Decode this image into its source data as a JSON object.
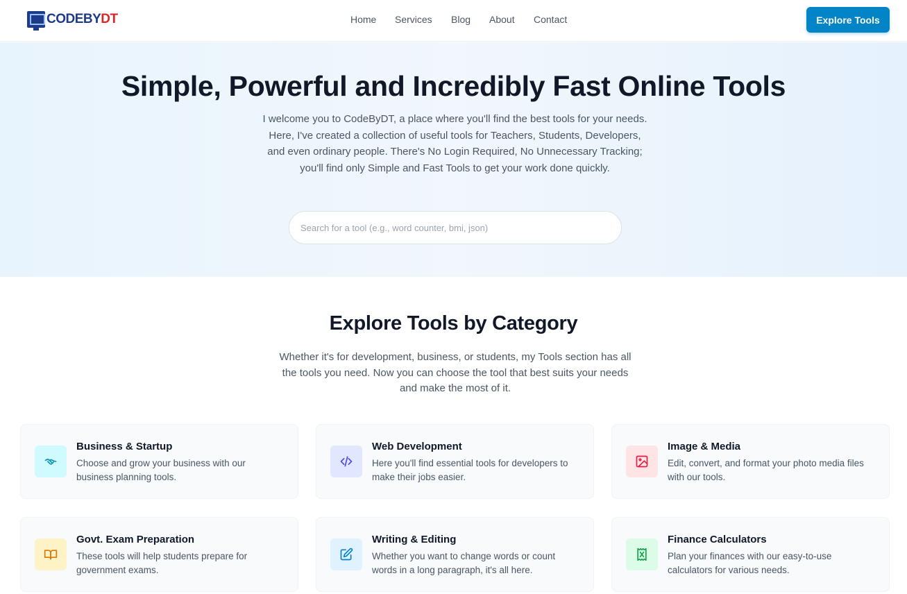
{
  "header": {
    "logo_text_a": "CODEBY",
    "logo_text_b": "DT",
    "nav": [
      {
        "label": "Home"
      },
      {
        "label": "Services"
      },
      {
        "label": "Blog"
      },
      {
        "label": "About"
      },
      {
        "label": "Contact"
      }
    ],
    "cta_label": "Explore Tools"
  },
  "hero": {
    "title": "Simple, Powerful and Incredibly Fast Online Tools",
    "description": "I welcome you to CodeByDT, a place where you'll find the best tools for your needs. Here, I've created a collection of useful tools for Teachers, Students, Developers, and even ordinary people. There's No Login Required, No Unnecessary Tracking; you'll find only Simple and Fast Tools to get your work done quickly.",
    "search_placeholder": "Search for a tool (e.g., word counter, bmi, json)",
    "search_value": ""
  },
  "categories": {
    "title": "Explore Tools by Category",
    "description": "Whether it's for development, business, or students, my Tools section has all the tools you need. Now you can choose the tool that best suits your needs and make the most of it.",
    "items": [
      {
        "title": "Business & Startup",
        "description": "Choose and grow your business with our business planning tools.",
        "icon": "handshake-icon",
        "icon_color": "#0891b2",
        "icon_bg": "#cffafe"
      },
      {
        "title": "Web Development",
        "description": "Here you'll find essential tools for developers to make their jobs easier.",
        "icon": "code-icon",
        "icon_color": "#4f46e5",
        "icon_bg": "#e0e7ff"
      },
      {
        "title": "Image & Media",
        "description": "Edit, convert, and format your photo media files with our tools.",
        "icon": "image-icon",
        "icon_color": "#e11d48",
        "icon_bg": "#ffe4e6"
      },
      {
        "title": "Govt. Exam Preparation",
        "description": "These tools will help students prepare for government exams.",
        "icon": "book-open-icon",
        "icon_color": "#d97706",
        "icon_bg": "#fef3c7"
      },
      {
        "title": "Writing & Editing",
        "description": "Whether you want to change words or count words in a long paragraph, it's all here.",
        "icon": "pencil-square-icon",
        "icon_color": "#0284c7",
        "icon_bg": "#e0f2fe"
      },
      {
        "title": "Finance Calculators",
        "description": "Plan your finances with our easy-to-use calculators for various needs.",
        "icon": "receipt-icon",
        "icon_color": "#16a34a",
        "icon_bg": "#dcfce7"
      }
    ]
  }
}
